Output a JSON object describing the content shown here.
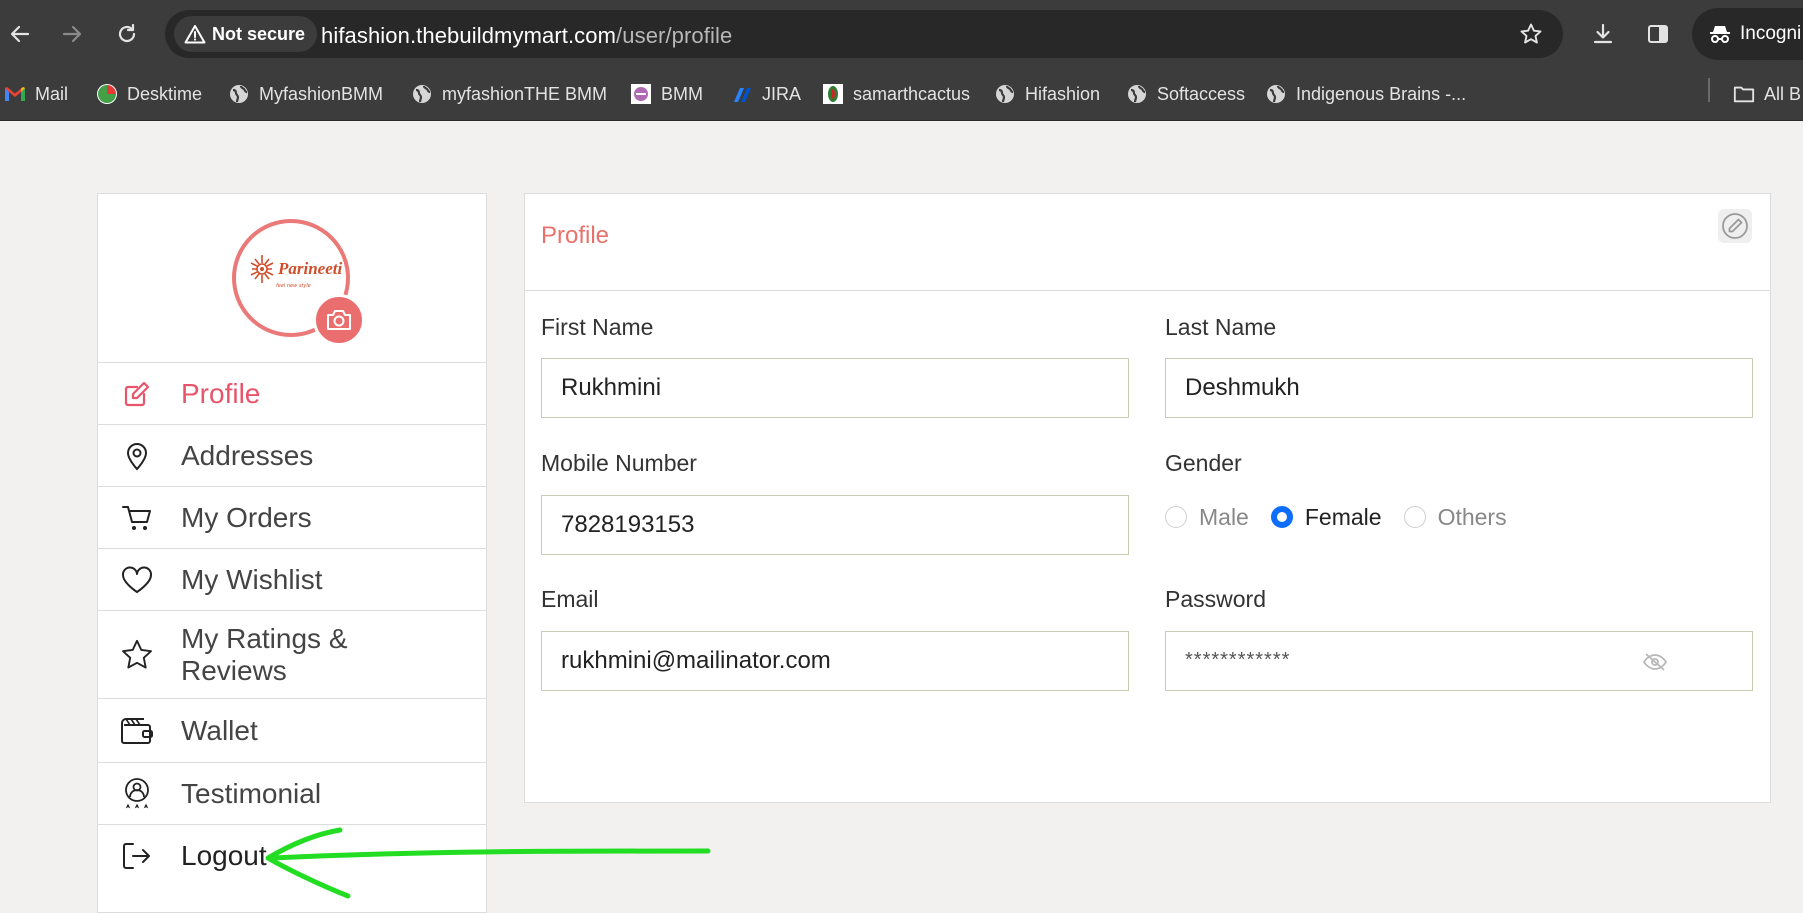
{
  "browser": {
    "security_label": "Not secure",
    "url_host": "hifashion.thebuildmymart.com",
    "url_path": "/user/profile",
    "incognito_label": "Incogni"
  },
  "bookmarks": {
    "items": [
      {
        "label": "Mail",
        "icon": "gmail-icon"
      },
      {
        "label": "Desktime",
        "icon": "desktime-icon"
      },
      {
        "label": "MyfashionBMM",
        "icon": "globe-icon"
      },
      {
        "label": "myfashionTHE BMM",
        "icon": "globe-icon"
      },
      {
        "label": "BMM",
        "icon": "bmm-logo-icon"
      },
      {
        "label": "JIRA",
        "icon": "jira-icon"
      },
      {
        "label": "samarthcactus",
        "icon": "samarth-icon"
      },
      {
        "label": "Hifashion",
        "icon": "globe-icon"
      },
      {
        "label": "Softaccess",
        "icon": "globe-icon"
      },
      {
        "label": "Indigenous Brains -...",
        "icon": "globe-icon"
      }
    ],
    "all_bookmarks_label": "All B"
  },
  "sidebar": {
    "brand_name": "Parineeti",
    "brand_tagline": "feel new style",
    "items": [
      {
        "label": "Profile",
        "icon": "edit-icon",
        "active": true
      },
      {
        "label": "Addresses",
        "icon": "location-pin-icon"
      },
      {
        "label": "My Orders",
        "icon": "cart-icon"
      },
      {
        "label": "My Wishlist",
        "icon": "heart-icon"
      },
      {
        "label": "My Ratings &",
        "label2": "Reviews",
        "icon": "star-icon"
      },
      {
        "label": "Wallet",
        "icon": "wallet-icon"
      },
      {
        "label": "Testimonial",
        "icon": "testimonial-icon"
      },
      {
        "label": "Logout",
        "icon": "logout-icon"
      }
    ]
  },
  "profile": {
    "title": "Profile",
    "first_name_label": "First Name",
    "first_name": "Rukhmini",
    "last_name_label": "Last Name",
    "last_name": "Deshmukh",
    "mobile_label": "Mobile Number",
    "mobile": "7828193153",
    "gender_label": "Gender",
    "gender_options": [
      "Male",
      "Female",
      "Others"
    ],
    "gender_selected": "Female",
    "email_label": "Email",
    "email": "rukhmini@mailinator.com",
    "password_label": "Password",
    "password_mask": "************"
  },
  "colors": {
    "accent": "#e8556a",
    "radio_checked": "#0d6efd",
    "annotation_arrow": "#22dd22"
  }
}
